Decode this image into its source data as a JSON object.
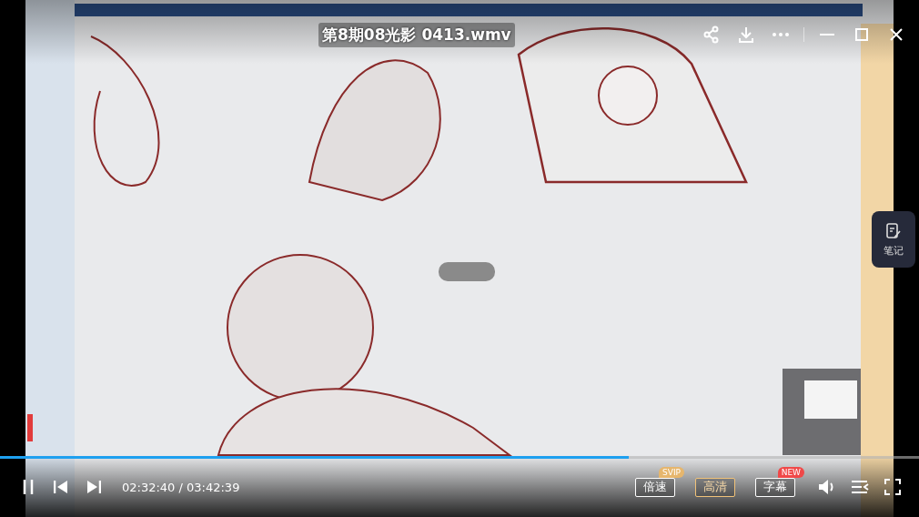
{
  "title": "第8期08光影 0413.wmv",
  "note_button": {
    "label": "笔记"
  },
  "progress": {
    "level": 0.684
  },
  "playing": true,
  "time": "02:32:40 / 03:42:39",
  "buttons": [
    {
      "label": "倍速",
      "highlighted": false,
      "badge": {
        "text": "SVIP",
        "color": "#e6b66d"
      }
    },
    {
      "label": "高清",
      "highlighted": true
    },
    {
      "label": "字幕",
      "highlighted": false,
      "badge": {
        "text": "NEW",
        "color": "#f04848"
      }
    }
  ]
}
